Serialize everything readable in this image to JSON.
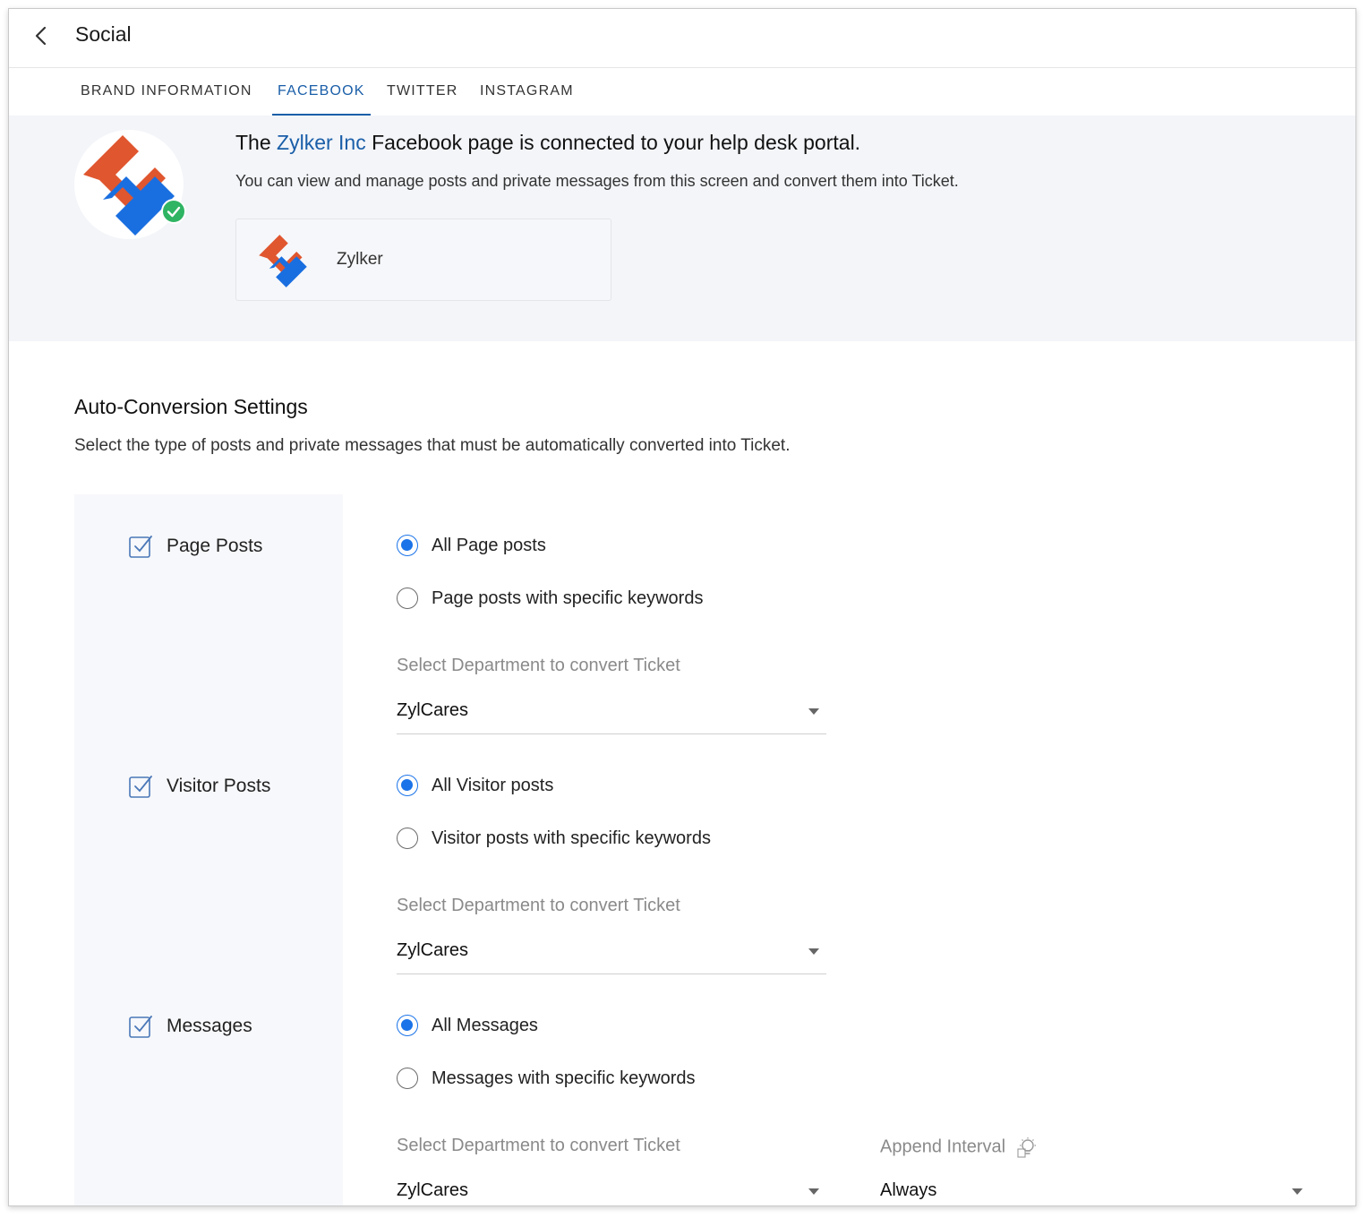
{
  "header": {
    "title": "Social"
  },
  "tabs": [
    {
      "label": "BRAND INFORMATION",
      "active": false
    },
    {
      "label": "FACEBOOK",
      "active": true
    },
    {
      "label": "TWITTER",
      "active": false
    },
    {
      "label": "INSTAGRAM",
      "active": false
    }
  ],
  "banner": {
    "headline_prefix": "The",
    "brand_name": "Zylker Inc",
    "headline_suffix": "Facebook page is connected to your help desk portal.",
    "subtext": "You can view and manage posts and private messages from this screen and convert them into Ticket.",
    "page_name": "Zylker"
  },
  "settings": {
    "title": "Auto-Conversion Settings",
    "description": "Select the type of posts and private messages that must be automatically converted into Ticket.",
    "groups": [
      {
        "label": "Page Posts",
        "checked": true,
        "options": [
          "All Page posts",
          "Page posts with specific keywords"
        ],
        "selected_option": 0,
        "department_label": "Select Department to convert Ticket",
        "department_value": "ZylCares"
      },
      {
        "label": "Visitor Posts",
        "checked": true,
        "options": [
          "All Visitor posts",
          "Visitor posts with specific keywords"
        ],
        "selected_option": 0,
        "department_label": "Select Department to convert Ticket",
        "department_value": "ZylCares"
      },
      {
        "label": "Messages",
        "checked": true,
        "options": [
          "All Messages",
          "Messages with specific keywords"
        ],
        "selected_option": 0,
        "department_label": "Select Department to convert Ticket",
        "department_value": "ZylCares",
        "append_interval_label": "Append Interval",
        "append_interval_value": "Always"
      }
    ]
  },
  "colors": {
    "accent": "#1a5ea8",
    "radio_selected": "#1a73e8",
    "logo_orange": "#e0562f",
    "logo_blue": "#1a6fe0",
    "verified_green": "#2fb463",
    "banner_bg": "#f3f5f9"
  },
  "icons": {
    "back": "chevron-left-icon",
    "verified": "check-circle-icon",
    "checkbox": "checkbox-checked-icon",
    "dropdown": "caret-down-icon",
    "append_interval_help": "lightbulb-icon"
  }
}
